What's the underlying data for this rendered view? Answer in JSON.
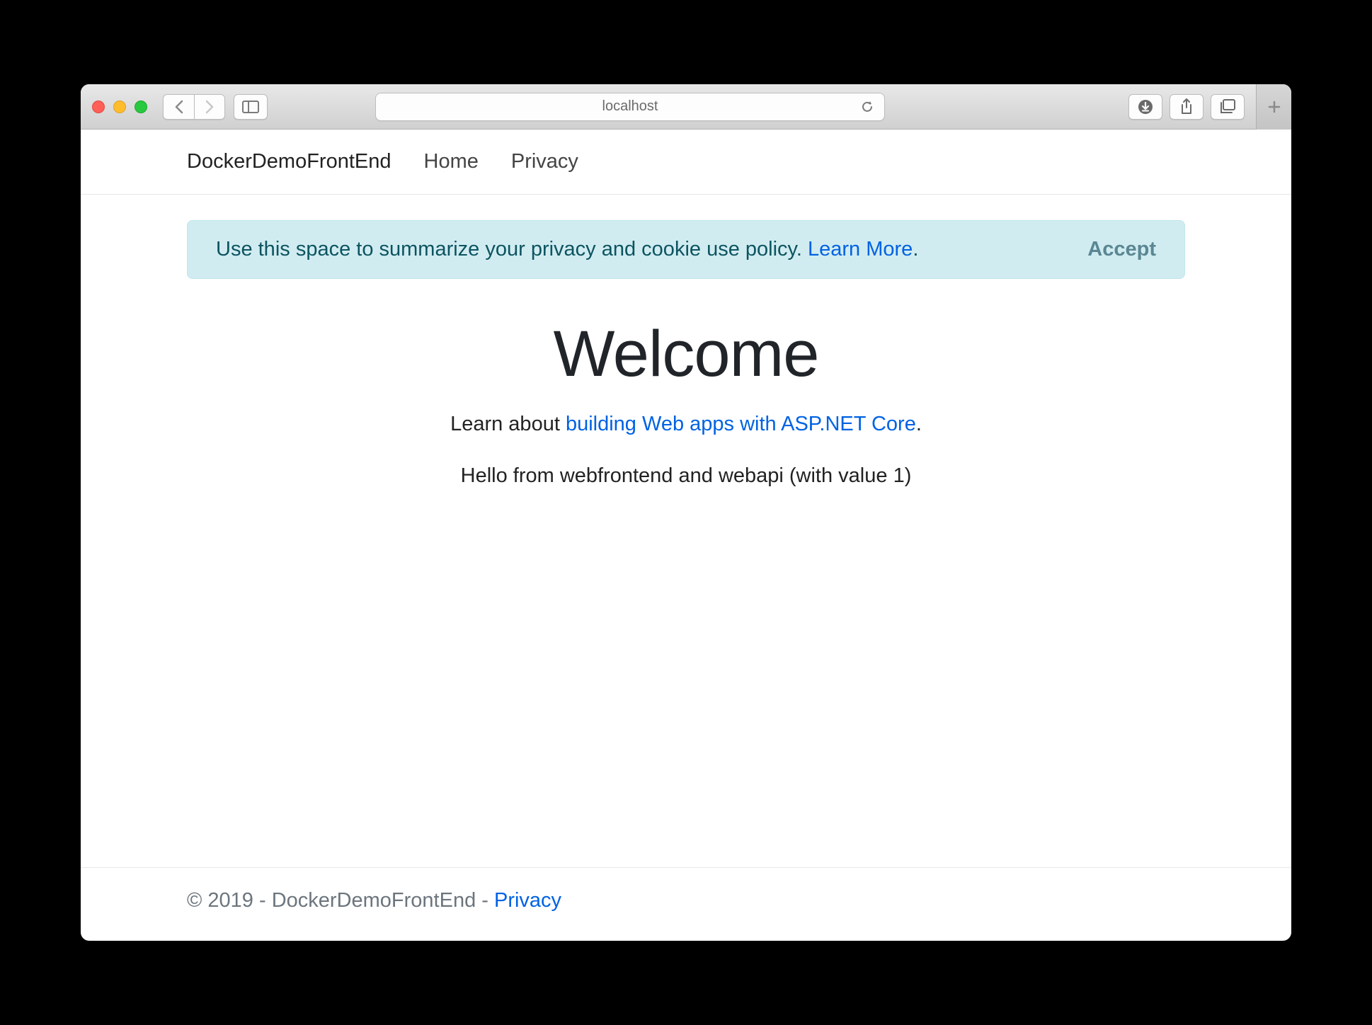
{
  "browser": {
    "address": "localhost"
  },
  "navbar": {
    "brand": "DockerDemoFrontEnd",
    "links": {
      "home": "Home",
      "privacy": "Privacy"
    }
  },
  "alert": {
    "text": "Use this space to summarize your privacy and cookie use policy. ",
    "learn": "Learn More",
    "period": ".",
    "accept": "Accept"
  },
  "hero": {
    "title": "Welcome",
    "lead_pre": "Learn about ",
    "lead_link": "building Web apps with ASP.NET Core",
    "lead_post": ".",
    "sub": "Hello from webfrontend and webapi (with value 1)"
  },
  "footer": {
    "text": "© 2019 - DockerDemoFrontEnd - ",
    "link": "Privacy"
  }
}
